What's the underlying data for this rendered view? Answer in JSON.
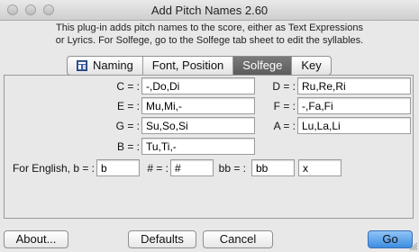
{
  "window": {
    "title": "Add Pitch Names 2.60"
  },
  "description": {
    "line1": "This plug-in adds pitch names to the score, either as Text Expressions",
    "line2": "or Lyrics. For Solfege, go to the Solfege tab sheet to edit the syllables."
  },
  "tabs": [
    {
      "label": "Naming",
      "icon": "plugin-icon"
    },
    {
      "label": "Font, Position"
    },
    {
      "label": "Solfege",
      "active": true
    },
    {
      "label": "Key"
    }
  ],
  "solfege": {
    "c": {
      "label": "C =  :",
      "value": "-,Do,Di"
    },
    "d": {
      "label": "D =  :",
      "value": "Ru,Re,Ri"
    },
    "e": {
      "label": "E =  :",
      "value": "Mu,Mi,-"
    },
    "f": {
      "label": "F =  :",
      "value": "-,Fa,Fi"
    },
    "g": {
      "label": "G =  :",
      "value": "Su,So,Si"
    },
    "a": {
      "label": "A =  :",
      "value": "Lu,La,Li"
    },
    "b": {
      "label": "B =  :",
      "value": "Tu,Ti,-"
    }
  },
  "english": {
    "label": "For English, b =  :",
    "b_value": "b",
    "sharp_label": "# =  :",
    "sharp_value": "#",
    "dbl_label": "bb =  :",
    "dbl_value": "bb",
    "x_value": "x"
  },
  "buttons": {
    "about": "About...",
    "defaults": "Defaults",
    "cancel": "Cancel",
    "go": "Go"
  }
}
